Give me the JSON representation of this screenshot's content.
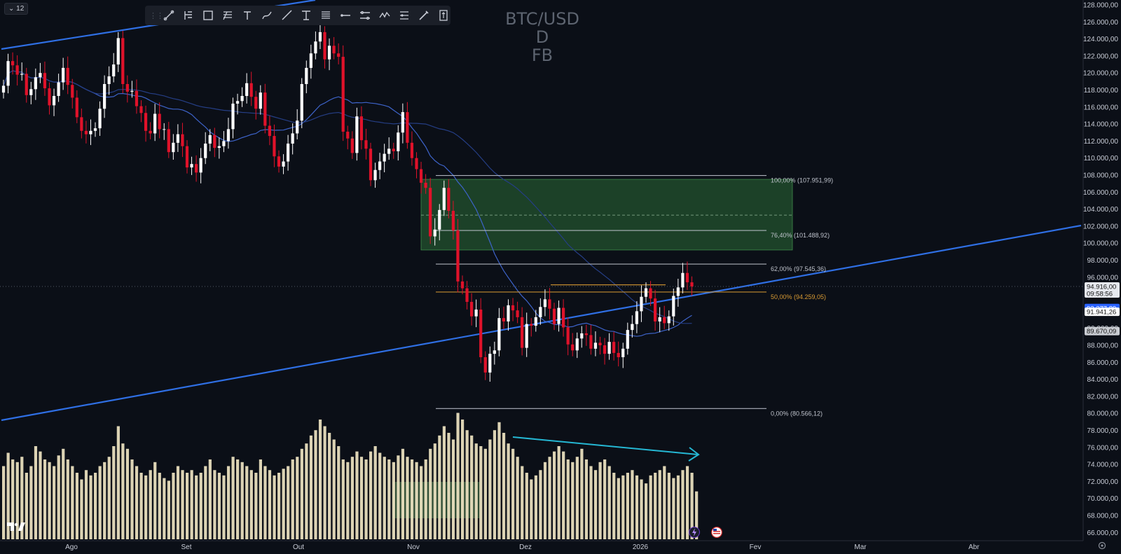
{
  "toolbar": {
    "items": [
      "drag-handle-icon",
      "trend-line-icon",
      "pitchfork-icon",
      "rectangle-icon",
      "fib-retracement-icon",
      "text-icon",
      "brush-icon",
      "ray-icon",
      "text-anchor-icon",
      "fib-lines-icon",
      "horizontal-ray-icon",
      "parallel-channel-icon",
      "pattern-icon",
      "projection-icon",
      "pen-icon",
      "price-range-icon"
    ]
  },
  "interval_badge": "12",
  "symbol": {
    "line1": "BTC/USD",
    "line2": "D",
    "line3": "FB"
  },
  "colors": {
    "background": "#0b0f17",
    "up_candle": "#ffffff",
    "down_candle": "#e0122a",
    "volume": "#efe4c2",
    "trendline": "#2f6fe4",
    "ma_line": "#2b4ea8",
    "fib_white": "#bfc3cc",
    "fib_orange": "#d89a33",
    "demand_zone": "#2c6b36",
    "arrow": "#25b7d3"
  },
  "chart_data": {
    "type": "candlestick",
    "y_axis_range": [
      65500,
      128700
    ],
    "y_ticks": [
      "128.000,00",
      "126.000,00",
      "124.000,00",
      "122.000,00",
      "120.000,00",
      "118.000,00",
      "116.000,00",
      "114.000,00",
      "112.000,00",
      "110.000,00",
      "108.000,00",
      "106.000,00",
      "104.000,00",
      "102.000,00",
      "100.000,00",
      "98.000,00",
      "96.000,00",
      "94.000,00",
      "92.000,00",
      "90.000,00",
      "88.000,00",
      "86.000,00",
      "84.000,00",
      "82.000,00",
      "80.000,00",
      "78.000,00",
      "76.000,00",
      "74.000,00",
      "72.000,00",
      "70.000,00",
      "68.000,00",
      "66.000,00"
    ],
    "x_ticks": [
      "Ago",
      "Set",
      "Out",
      "Nov",
      "Dez",
      "2026",
      "Fev",
      "Mar",
      "Abr"
    ],
    "price_labels": [
      {
        "text": "94.916,00",
        "sub": "09:58:56",
        "value": 94916,
        "color": "#e6e8ee",
        "text_color": "#111111"
      },
      {
        "text": "92.377,89",
        "value": 92378,
        "color": "#2962ff",
        "text_color": "#ffffff"
      },
      {
        "text": "91.941,26",
        "value": 91941,
        "color": "#ffffff",
        "text_color": "#111111"
      },
      {
        "text": "89.670,09",
        "value": 89670,
        "color": "#c9ccd2",
        "text_color": "#111111"
      }
    ],
    "fib_levels": [
      {
        "label": "100,00% (107.951,99)",
        "value": 107952,
        "color": "#ffffff"
      },
      {
        "label": "76,40% (101.488,92)",
        "value": 101489,
        "color": "#ffffff"
      },
      {
        "label": "62,00% (97.545,36)",
        "value": 97545,
        "color": "#ffffff"
      },
      {
        "label": "50,00% (94.259,05)",
        "value": 94259,
        "color": "#d89a33"
      },
      {
        "label": "0,00% (80.566,12)",
        "value": 80566,
        "color": "#ffffff"
      }
    ],
    "closes": [
      118500,
      121400,
      120900,
      119800,
      119900,
      117400,
      118100,
      119500,
      120000,
      118200,
      116200,
      117300,
      118900,
      120600,
      118600,
      117100,
      114800,
      113200,
      112800,
      113200,
      113500,
      115800,
      118700,
      119600,
      121000,
      124100,
      118700,
      117800,
      117900,
      116100,
      115300,
      113200,
      112900,
      115200,
      113400,
      113400,
      110700,
      111800,
      112800,
      111400,
      108900,
      109300,
      108300,
      110000,
      111700,
      112700,
      111200,
      111400,
      112000,
      113400,
      116400,
      116700,
      117300,
      118800,
      117200,
      115800,
      117700,
      113800,
      112600,
      110200,
      109000,
      109600,
      111700,
      112900,
      114400,
      118700,
      120600,
      122300,
      123700,
      124800,
      121600,
      123200,
      122300,
      121900,
      113100,
      112300,
      110600,
      114900,
      112100,
      111100,
      107400,
      108600,
      109600,
      110500,
      111100,
      110800,
      113000,
      115400,
      111800,
      110000,
      108700,
      107100,
      106500,
      100800,
      101600,
      103900,
      106500,
      103800,
      101500,
      95500,
      94700,
      93100,
      91400,
      92200,
      86600,
      84800,
      87000,
      87400,
      91200,
      90800,
      92700,
      92100,
      91300,
      87700,
      90500,
      90300,
      91300,
      92500,
      93400,
      92300,
      90500,
      92400,
      90100,
      88100,
      87400,
      88800,
      89400,
      89200,
      87600,
      88300,
      88000,
      87000,
      88400,
      87100,
      86600,
      87600,
      89800,
      90500,
      92000,
      93700,
      94700,
      93500,
      90800,
      91300,
      90600,
      91400,
      93800,
      94800,
      96500,
      95400,
      94916
    ],
    "volumes": [
      0.55,
      0.65,
      0.6,
      0.58,
      0.62,
      0.5,
      0.55,
      0.7,
      0.66,
      0.6,
      0.58,
      0.55,
      0.63,
      0.68,
      0.6,
      0.55,
      0.5,
      0.45,
      0.52,
      0.48,
      0.5,
      0.55,
      0.58,
      0.62,
      0.7,
      0.85,
      0.72,
      0.68,
      0.6,
      0.55,
      0.5,
      0.48,
      0.52,
      0.58,
      0.5,
      0.46,
      0.44,
      0.5,
      0.55,
      0.52,
      0.5,
      0.52,
      0.48,
      0.5,
      0.55,
      0.6,
      0.52,
      0.5,
      0.48,
      0.55,
      0.62,
      0.6,
      0.58,
      0.55,
      0.52,
      0.5,
      0.6,
      0.55,
      0.52,
      0.48,
      0.5,
      0.53,
      0.55,
      0.6,
      0.62,
      0.68,
      0.72,
      0.78,
      0.82,
      0.9,
      0.85,
      0.8,
      0.75,
      0.7,
      0.6,
      0.58,
      0.62,
      0.66,
      0.62,
      0.6,
      0.66,
      0.7,
      0.65,
      0.62,
      0.6,
      0.58,
      0.63,
      0.68,
      0.62,
      0.6,
      0.58,
      0.55,
      0.6,
      0.68,
      0.72,
      0.78,
      0.85,
      0.8,
      0.75,
      0.95,
      0.9,
      0.82,
      0.78,
      0.72,
      0.7,
      0.68,
      0.75,
      0.82,
      0.88,
      0.8,
      0.72,
      0.68,
      0.62,
      0.55,
      0.5,
      0.45,
      0.48,
      0.52,
      0.58,
      0.62,
      0.66,
      0.7,
      0.66,
      0.6,
      0.58,
      0.62,
      0.68,
      0.6,
      0.55,
      0.52,
      0.58,
      0.6,
      0.55,
      0.5,
      0.46,
      0.48,
      0.5,
      0.52,
      0.48,
      0.45,
      0.42,
      0.48,
      0.5,
      0.52,
      0.55,
      0.5,
      0.46,
      0.48,
      0.52,
      0.55,
      0.5,
      0.36
    ]
  }
}
